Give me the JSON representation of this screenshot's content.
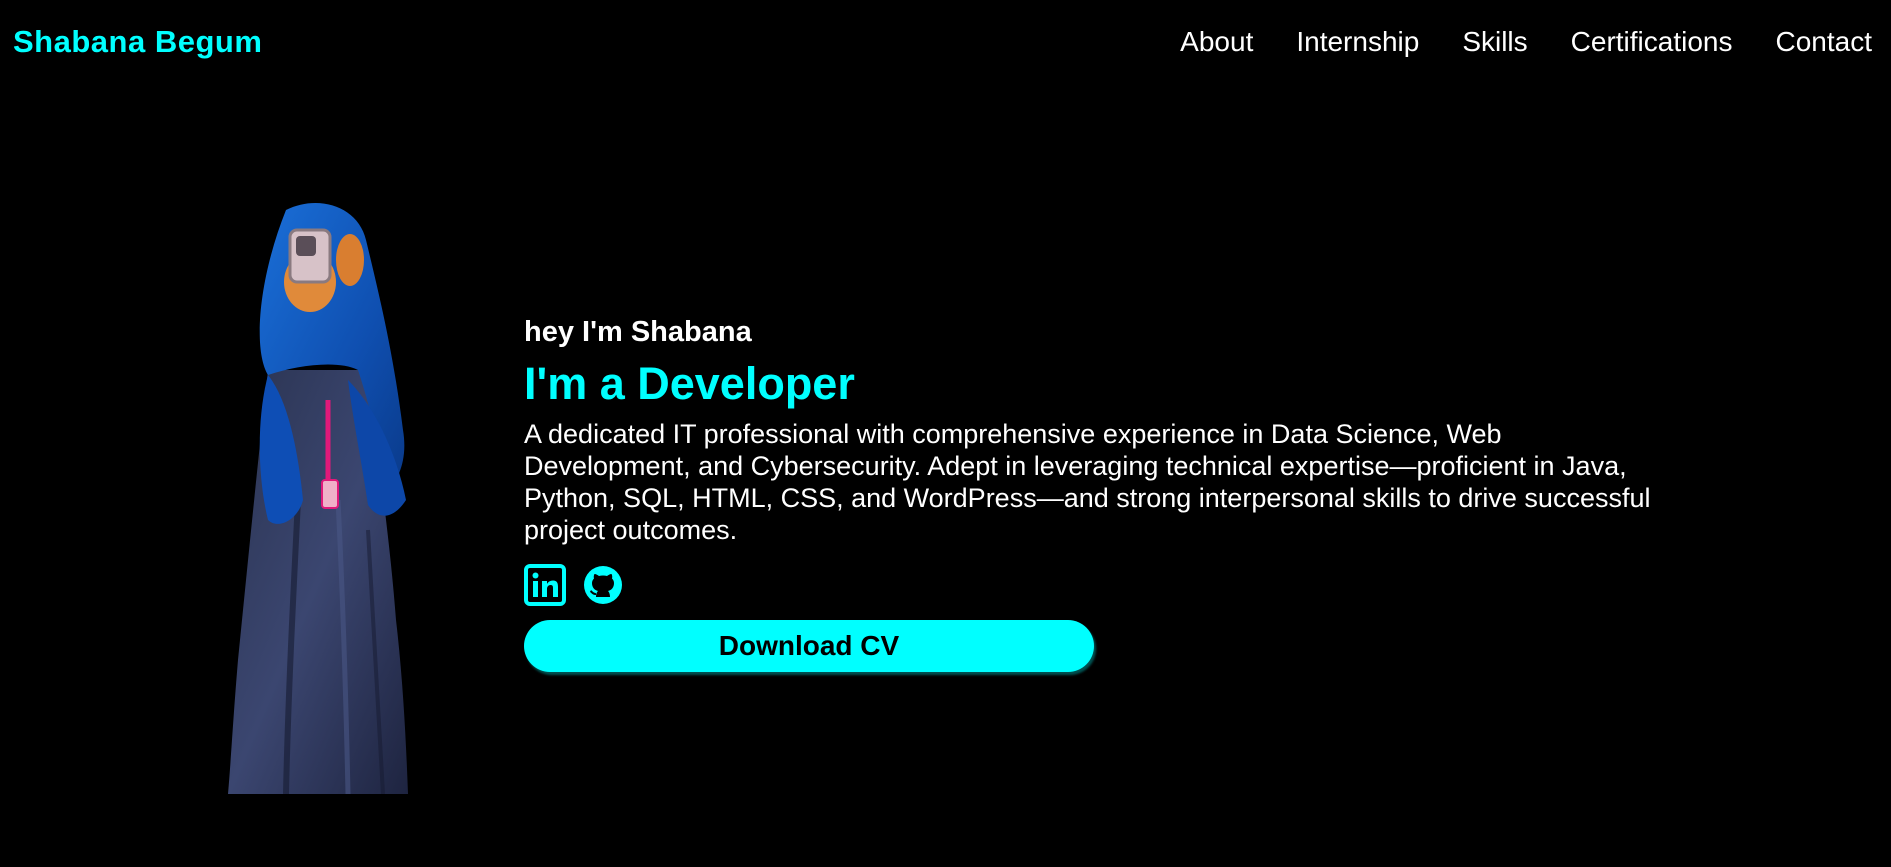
{
  "header": {
    "logo": "Shabana Begum",
    "nav": [
      {
        "label": "About"
      },
      {
        "label": "Internship"
      },
      {
        "label": "Skills"
      },
      {
        "label": "Certifications"
      },
      {
        "label": "Contact"
      }
    ]
  },
  "hero": {
    "greeting": "hey I'm Shabana",
    "role": "I'm a Developer",
    "description": "A dedicated IT professional with comprehensive experience in Data Science, Web Development, and Cybersecurity. Adept in leveraging technical expertise—proficient in Java, Python, SQL, HTML, CSS, and WordPress—and strong interpersonal skills to drive successful project outcomes.",
    "socials": [
      {
        "icon": "linkedin-icon"
      },
      {
        "icon": "github-icon"
      }
    ],
    "cv_button": "Download CV"
  },
  "colors": {
    "background": "#000000",
    "accent": "#00ffff",
    "text": "#ffffff",
    "button_text": "#000000"
  }
}
